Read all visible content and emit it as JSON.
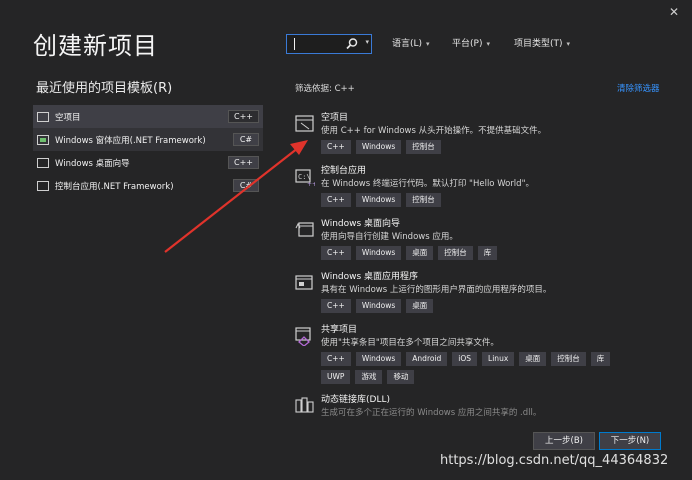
{
  "window": {
    "title": "创建新项目",
    "close_glyph": "✕"
  },
  "search": {
    "value": ""
  },
  "filters": [
    {
      "label": "语言(L)"
    },
    {
      "label": "平台(P)"
    },
    {
      "label": "项目类型(T)"
    }
  ],
  "recent": {
    "title": "最近使用的项目模板(R)",
    "items": [
      {
        "label": "空项目",
        "tag": "C++"
      },
      {
        "label": "Windows 窗体应用(.NET Framework)",
        "tag": "C#"
      },
      {
        "label": "Windows 桌面向导",
        "tag": "C++"
      },
      {
        "label": "控制台应用(.NET Framework)",
        "tag": "C#"
      }
    ]
  },
  "filter_label": "筛选依据: C++",
  "clear_filters": "清除筛选器",
  "templates": [
    {
      "name": "空项目",
      "desc": "使用 C++ for Windows 从头开始操作。不提供基础文件。",
      "tags": [
        "C++",
        "Windows",
        "控制台"
      ]
    },
    {
      "name": "控制台应用",
      "desc": "在 Windows 终端运行代码。默认打印 \"Hello World\"。",
      "tags": [
        "C++",
        "Windows",
        "控制台"
      ]
    },
    {
      "name": "Windows 桌面向导",
      "desc": "使用向导自行创建 Windows 应用。",
      "tags": [
        "C++",
        "Windows",
        "桌面",
        "控制台",
        "库"
      ]
    },
    {
      "name": "Windows 桌面应用程序",
      "desc": "具有在 Windows 上运行的图形用户界面的应用程序的项目。",
      "tags": [
        "C++",
        "Windows",
        "桌面"
      ]
    },
    {
      "name": "共享项目",
      "desc": "使用\"共享条目\"项目在多个项目之间共享文件。",
      "tags": [
        "C++",
        "Windows",
        "Android",
        "iOS",
        "Linux",
        "桌面",
        "控制台",
        "库",
        "UWP",
        "游戏",
        "移动"
      ]
    },
    {
      "name": "动态链接库(DLL)",
      "desc": "生成可在多个正在运行的 Windows 应用之间共享的 .dll。",
      "tags": []
    }
  ],
  "buttons": {
    "back": "上一步(B)",
    "next": "下一步(N)"
  },
  "watermark": "https://blog.csdn.net/qq_44364832",
  "colors": {
    "background": "#252526",
    "accent": "#3794ff",
    "arrow": "#e0332b"
  }
}
